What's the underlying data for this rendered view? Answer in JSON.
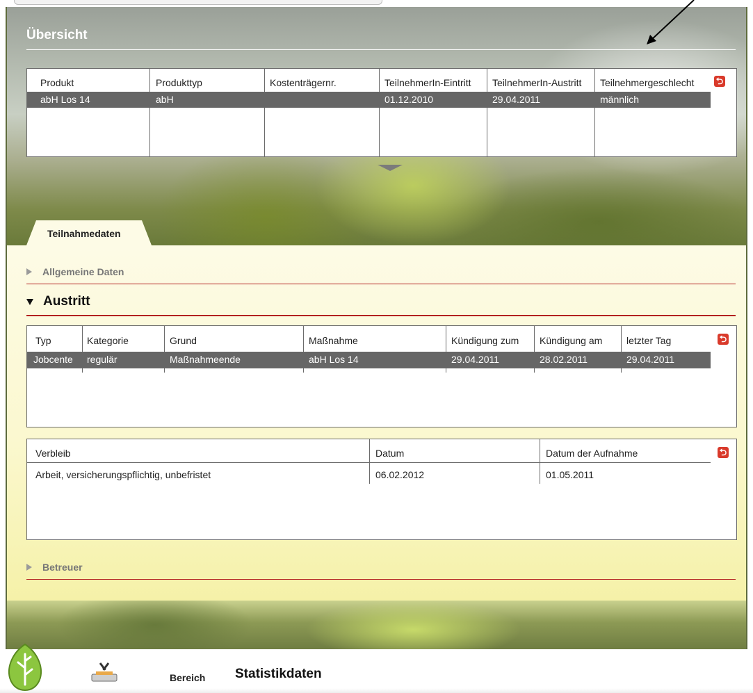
{
  "overview": {
    "title": "Übersicht",
    "columns": [
      "Produkt",
      "Produkttyp",
      "Kostenträgernr.",
      "TeilnehmerIn-Eintritt",
      "TeilnehmerIn-Austritt",
      "Teilnehmergeschlecht"
    ],
    "rows": [
      [
        "abH Los 14",
        "abH",
        "",
        "01.12.2010",
        "29.04.2011",
        "männlich"
      ]
    ]
  },
  "tabs": [
    {
      "label": "Teilnahmedaten",
      "active": true
    }
  ],
  "sections": {
    "general": {
      "label": "Allgemeine Daten",
      "expanded": false
    },
    "exit": {
      "label": "Austritt",
      "expanded": true
    },
    "caretaker": {
      "label": "Betreuer",
      "expanded": false
    }
  },
  "exit_table": {
    "columns": [
      "Typ",
      "Kategorie",
      "Grund",
      "Maßnahme",
      "Kündigung zum",
      "Kündigung am",
      "letzter Tag"
    ],
    "rows": [
      [
        "Jobcente",
        "regulär",
        "Maßnahmeende",
        "abH Los 14",
        "29.04.2011",
        "28.02.2011",
        "29.04.2011"
      ]
    ]
  },
  "whereabouts_table": {
    "columns": [
      "Verbleib",
      "Datum",
      "Datum der Aufnahme"
    ],
    "rows": [
      [
        "Arbeit, versicherungspflichtig, unbefristet",
        "06.02.2012",
        "01.05.2011"
      ]
    ]
  },
  "footer": {
    "area_label": "Bereich",
    "area_title": "Statistikdaten"
  },
  "icons": {
    "export": "exit-icon",
    "collapse": "collapse-arrow-icon",
    "logo": "leaf-logo-icon",
    "tool": "stamp-icon",
    "annotation": "arrow-annotation-icon"
  },
  "colors": {
    "selected_row": "#666666",
    "accent_red": "#b22020",
    "export_icon": "#d93a2b",
    "panel_yellow": "#fbf8cf"
  }
}
